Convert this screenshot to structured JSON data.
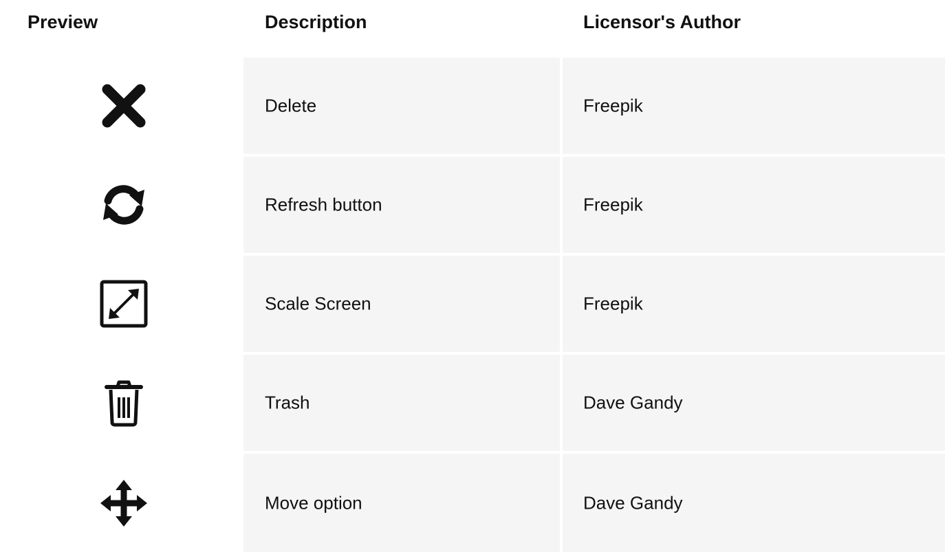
{
  "table": {
    "headers": {
      "preview": "Preview",
      "description": "Description",
      "author": "Licensor's Author"
    },
    "rows": [
      {
        "icon": "close-x-icon",
        "description": "Delete",
        "author": "Freepik"
      },
      {
        "icon": "refresh-icon",
        "description": "Refresh button",
        "author": "Freepik"
      },
      {
        "icon": "scale-screen-icon",
        "description": "Scale Screen",
        "author": "Freepik"
      },
      {
        "icon": "trash-icon",
        "description": "Trash",
        "author": "Dave Gandy"
      },
      {
        "icon": "move-arrows-icon",
        "description": "Move option",
        "author": "Dave Gandy"
      }
    ]
  },
  "colors": {
    "text": "#111111",
    "cell_background": "#f5f5f5",
    "page_background": "#ffffff"
  }
}
